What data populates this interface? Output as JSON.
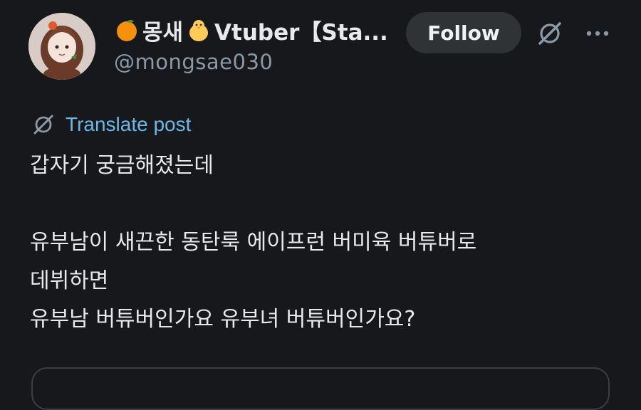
{
  "author": {
    "display_name": "몽새",
    "display_name_suffix": "Vtuber【Sta...",
    "handle": "@mongsae030",
    "leading_emoji": "orange",
    "trailing_emoji": "chick"
  },
  "actions": {
    "follow_label": "Follow",
    "grok_icon": "grok-icon",
    "more_icon": "more-icon"
  },
  "translate": {
    "label": "Translate post"
  },
  "post": {
    "line1": "갑자기 궁금해졌는데",
    "line2": "유부남이 새끈한 동탄룩 에이프런 버미육 버튜버로",
    "line3": "데뷔하면",
    "line4": "유부남 버튜버인가요 유부녀 버튜버인가요?"
  },
  "colors": {
    "background": "#16181c",
    "text": "#e7e9ea",
    "secondary": "#8b98a5",
    "link": "#6cb8e6",
    "button_bg": "#2f3336"
  }
}
